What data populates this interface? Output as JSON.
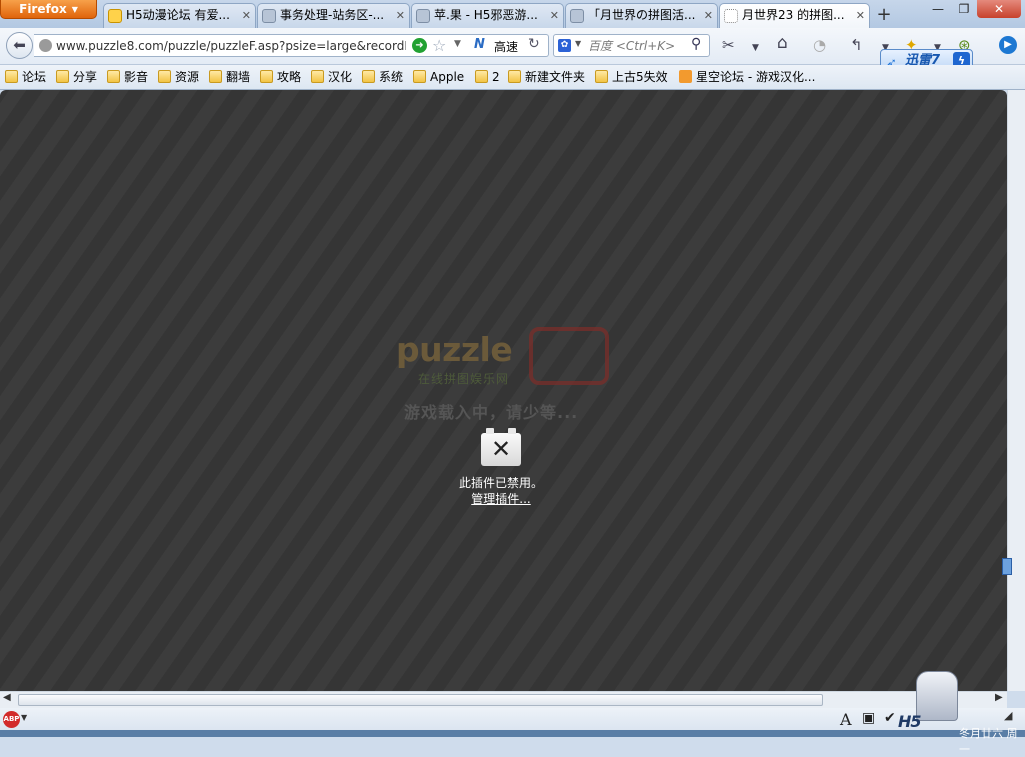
{
  "browser": {
    "menu_label": "Firefox",
    "tabs": [
      {
        "title": "H5动漫论坛 有爱...",
        "icon": "h5-favicon"
      },
      {
        "title": "事务处理-站务区-...",
        "icon": "site-favicon"
      },
      {
        "title": "苹.果 - H5邪恶游...",
        "icon": "site-favicon"
      },
      {
        "title": "「月世界の拼图活...",
        "icon": "site-favicon"
      },
      {
        "title": "月世界23 的拼图...",
        "icon": "blank-page-favicon"
      }
    ],
    "new_tab_label": "+",
    "window_controls": {
      "minimize": "—",
      "maximize": "❐",
      "close": "✕"
    }
  },
  "navbar": {
    "url": "www.puzzle8.com/puzzle/puzzleF.asp?psize=large&recordIc",
    "speed_label": "高速",
    "search_placeholder": "百度 <Ctrl+K>"
  },
  "addons": {
    "xunlei_label": "迅雷7",
    "xunlei_bolt": "ϟ"
  },
  "bookmarks": [
    {
      "label": "论坛"
    },
    {
      "label": "分享"
    },
    {
      "label": "影音"
    },
    {
      "label": "资源"
    },
    {
      "label": "翻墙"
    },
    {
      "label": "攻略"
    },
    {
      "label": "汉化"
    },
    {
      "label": "系统"
    },
    {
      "label": "Apple"
    },
    {
      "label": "2"
    },
    {
      "label": "新建文件夹"
    },
    {
      "label": "上古5失效"
    },
    {
      "label": "星空论坛 - 游戏汉化..."
    }
  ],
  "page": {
    "logo_text": "puzzle",
    "logo_subtitle": "在线拼图娱乐网",
    "loading_text": "游戏载入中，请少等...",
    "plugin_disabled": "此插件已禁用。",
    "plugin_manage": "管理插件..."
  },
  "status": {
    "abp_label": "ABP",
    "h5_logo": "H5",
    "date": "冬月廿六 周一"
  },
  "colors": {
    "firefox_orange": "#e0640b",
    "content_dark": "#3a3a3a",
    "go_green": "#22a132"
  }
}
